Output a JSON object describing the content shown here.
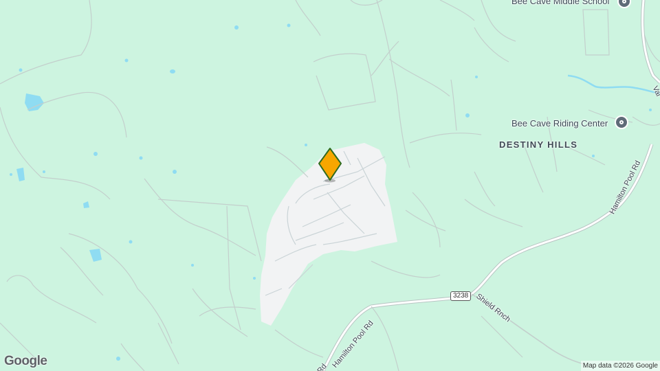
{
  "map": {
    "colors": {
      "land": "#cdf4e0",
      "water": "#8fdcf2",
      "developed": "#f2f3f4",
      "road": "#c5d2cf",
      "highway": "#ffffff",
      "marker_fill": "#f7a600",
      "marker_stroke": "#2f6b1f"
    },
    "pois": [
      {
        "label": "Bee Cave Middle School",
        "icon": "school-pin-icon"
      },
      {
        "label": "Bee Cave Riding Center",
        "icon": "pin-icon"
      }
    ],
    "areas": [
      {
        "label": "DESTINY HILLS"
      }
    ],
    "roads": [
      {
        "label": "Hamilton Pool Rd"
      },
      {
        "label": "Hamilton Pool Rd"
      },
      {
        "label": "Shield Rnch"
      },
      {
        "label": "Val"
      },
      {
        "label": "Rd"
      }
    ],
    "route_shield": "3238",
    "marker": {
      "icon": "diamond-marker-icon"
    },
    "branding": "Google",
    "attribution": "Map data ©2026 Google"
  }
}
